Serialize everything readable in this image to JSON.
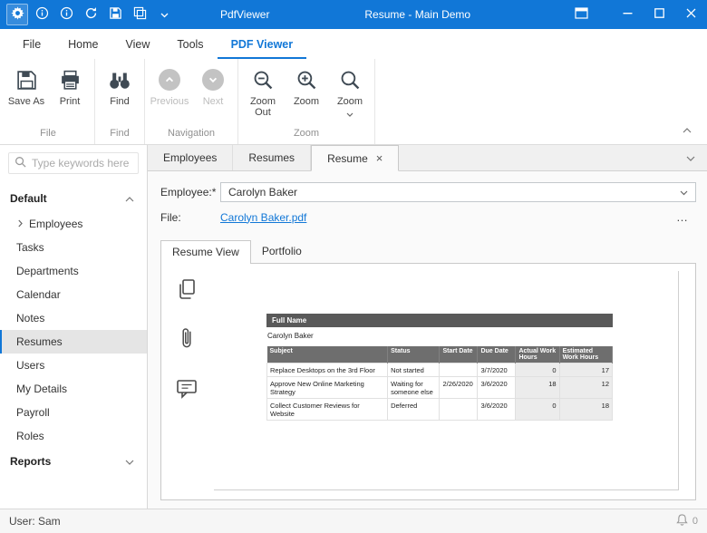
{
  "titlebar": {
    "app_name": "PdfViewer",
    "window_title": "Resume - Main Demo"
  },
  "menubar": {
    "items": [
      "File",
      "Home",
      "View",
      "Tools",
      "PDF Viewer"
    ]
  },
  "ribbon": {
    "groups": {
      "file": "File",
      "find": "Find",
      "navigation": "Navigation",
      "zoom": "Zoom"
    },
    "buttons": {
      "save_as": "Save As",
      "print": "Print",
      "find": "Find",
      "previous": "Previous",
      "next": "Next",
      "zoom_out": "Zoom Out",
      "zoom_in": "Zoom In",
      "zoom": "Zoom"
    }
  },
  "sidebar": {
    "search_placeholder": "Type keywords here",
    "sections": {
      "default": "Default",
      "reports": "Reports"
    },
    "items": [
      "Employees",
      "Tasks",
      "Departments",
      "Calendar",
      "Notes",
      "Resumes",
      "Users",
      "My Details",
      "Payroll",
      "Roles"
    ]
  },
  "doc_tabs": {
    "items": [
      "Employees",
      "Resumes",
      "Resume"
    ]
  },
  "form": {
    "employee_label": "Employee:*",
    "employee_value": "Carolyn Baker",
    "file_label": "File:",
    "file_link": "Carolyn Baker.pdf"
  },
  "viewer_tabs": {
    "items": [
      "Resume View",
      "Portfolio"
    ]
  },
  "resume": {
    "full_name_header": "Full Name",
    "full_name": "Carolyn Baker",
    "table": {
      "headers": [
        "Subject",
        "Status",
        "Start Date",
        "Due Date",
        "Actual Work Hours",
        "Estimated Work Hours"
      ],
      "rows": [
        [
          "Replace Desktops on the 3rd Floor",
          "Not started",
          "",
          "3/7/2020",
          "0",
          "17"
        ],
        [
          "Approve New Online Marketing Strategy",
          "Waiting for someone else",
          "2/26/2020",
          "3/6/2020",
          "18",
          "12"
        ],
        [
          "Collect Customer Reviews for Website",
          "Deferred",
          "",
          "3/6/2020",
          "0",
          "18"
        ]
      ]
    }
  },
  "statusbar": {
    "user": "User: Sam",
    "notification_count": "0"
  },
  "icons": {
    "ellipsis": "…",
    "close_tab": "×"
  },
  "colors": {
    "accent": "#1177d7",
    "titlebar": "#1177d7"
  }
}
